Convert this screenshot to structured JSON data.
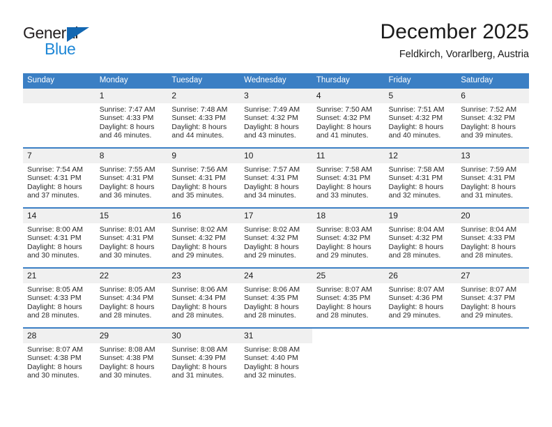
{
  "logo": {
    "word1": "General",
    "word2": "Blue",
    "triangle_color": "#1267b2",
    "word2_color": "#1e87d6"
  },
  "header": {
    "title": "December 2025",
    "subtitle": "Feldkirch, Vorarlberg, Austria"
  },
  "theme": {
    "header_bg": "#3b7fc4",
    "daynum_bg": "#f0f0f0",
    "text": "#1a1a1a"
  },
  "calendar": {
    "weekday_headers": [
      "Sunday",
      "Monday",
      "Tuesday",
      "Wednesday",
      "Thursday",
      "Friday",
      "Saturday"
    ],
    "weeks": [
      [
        {
          "day": "",
          "blank": true,
          "sunrise": "",
          "sunset": "",
          "daylight1": "",
          "daylight2": ""
        },
        {
          "day": "1",
          "sunrise": "Sunrise: 7:47 AM",
          "sunset": "Sunset: 4:33 PM",
          "daylight1": "Daylight: 8 hours",
          "daylight2": "and 46 minutes."
        },
        {
          "day": "2",
          "sunrise": "Sunrise: 7:48 AM",
          "sunset": "Sunset: 4:33 PM",
          "daylight1": "Daylight: 8 hours",
          "daylight2": "and 44 minutes."
        },
        {
          "day": "3",
          "sunrise": "Sunrise: 7:49 AM",
          "sunset": "Sunset: 4:32 PM",
          "daylight1": "Daylight: 8 hours",
          "daylight2": "and 43 minutes."
        },
        {
          "day": "4",
          "sunrise": "Sunrise: 7:50 AM",
          "sunset": "Sunset: 4:32 PM",
          "daylight1": "Daylight: 8 hours",
          "daylight2": "and 41 minutes."
        },
        {
          "day": "5",
          "sunrise": "Sunrise: 7:51 AM",
          "sunset": "Sunset: 4:32 PM",
          "daylight1": "Daylight: 8 hours",
          "daylight2": "and 40 minutes."
        },
        {
          "day": "6",
          "sunrise": "Sunrise: 7:52 AM",
          "sunset": "Sunset: 4:32 PM",
          "daylight1": "Daylight: 8 hours",
          "daylight2": "and 39 minutes."
        }
      ],
      [
        {
          "day": "7",
          "sunrise": "Sunrise: 7:54 AM",
          "sunset": "Sunset: 4:31 PM",
          "daylight1": "Daylight: 8 hours",
          "daylight2": "and 37 minutes."
        },
        {
          "day": "8",
          "sunrise": "Sunrise: 7:55 AM",
          "sunset": "Sunset: 4:31 PM",
          "daylight1": "Daylight: 8 hours",
          "daylight2": "and 36 minutes."
        },
        {
          "day": "9",
          "sunrise": "Sunrise: 7:56 AM",
          "sunset": "Sunset: 4:31 PM",
          "daylight1": "Daylight: 8 hours",
          "daylight2": "and 35 minutes."
        },
        {
          "day": "10",
          "sunrise": "Sunrise: 7:57 AM",
          "sunset": "Sunset: 4:31 PM",
          "daylight1": "Daylight: 8 hours",
          "daylight2": "and 34 minutes."
        },
        {
          "day": "11",
          "sunrise": "Sunrise: 7:58 AM",
          "sunset": "Sunset: 4:31 PM",
          "daylight1": "Daylight: 8 hours",
          "daylight2": "and 33 minutes."
        },
        {
          "day": "12",
          "sunrise": "Sunrise: 7:58 AM",
          "sunset": "Sunset: 4:31 PM",
          "daylight1": "Daylight: 8 hours",
          "daylight2": "and 32 minutes."
        },
        {
          "day": "13",
          "sunrise": "Sunrise: 7:59 AM",
          "sunset": "Sunset: 4:31 PM",
          "daylight1": "Daylight: 8 hours",
          "daylight2": "and 31 minutes."
        }
      ],
      [
        {
          "day": "14",
          "sunrise": "Sunrise: 8:00 AM",
          "sunset": "Sunset: 4:31 PM",
          "daylight1": "Daylight: 8 hours",
          "daylight2": "and 30 minutes."
        },
        {
          "day": "15",
          "sunrise": "Sunrise: 8:01 AM",
          "sunset": "Sunset: 4:31 PM",
          "daylight1": "Daylight: 8 hours",
          "daylight2": "and 30 minutes."
        },
        {
          "day": "16",
          "sunrise": "Sunrise: 8:02 AM",
          "sunset": "Sunset: 4:32 PM",
          "daylight1": "Daylight: 8 hours",
          "daylight2": "and 29 minutes."
        },
        {
          "day": "17",
          "sunrise": "Sunrise: 8:02 AM",
          "sunset": "Sunset: 4:32 PM",
          "daylight1": "Daylight: 8 hours",
          "daylight2": "and 29 minutes."
        },
        {
          "day": "18",
          "sunrise": "Sunrise: 8:03 AM",
          "sunset": "Sunset: 4:32 PM",
          "daylight1": "Daylight: 8 hours",
          "daylight2": "and 29 minutes."
        },
        {
          "day": "19",
          "sunrise": "Sunrise: 8:04 AM",
          "sunset": "Sunset: 4:32 PM",
          "daylight1": "Daylight: 8 hours",
          "daylight2": "and 28 minutes."
        },
        {
          "day": "20",
          "sunrise": "Sunrise: 8:04 AM",
          "sunset": "Sunset: 4:33 PM",
          "daylight1": "Daylight: 8 hours",
          "daylight2": "and 28 minutes."
        }
      ],
      [
        {
          "day": "21",
          "sunrise": "Sunrise: 8:05 AM",
          "sunset": "Sunset: 4:33 PM",
          "daylight1": "Daylight: 8 hours",
          "daylight2": "and 28 minutes."
        },
        {
          "day": "22",
          "sunrise": "Sunrise: 8:05 AM",
          "sunset": "Sunset: 4:34 PM",
          "daylight1": "Daylight: 8 hours",
          "daylight2": "and 28 minutes."
        },
        {
          "day": "23",
          "sunrise": "Sunrise: 8:06 AM",
          "sunset": "Sunset: 4:34 PM",
          "daylight1": "Daylight: 8 hours",
          "daylight2": "and 28 minutes."
        },
        {
          "day": "24",
          "sunrise": "Sunrise: 8:06 AM",
          "sunset": "Sunset: 4:35 PM",
          "daylight1": "Daylight: 8 hours",
          "daylight2": "and 28 minutes."
        },
        {
          "day": "25",
          "sunrise": "Sunrise: 8:07 AM",
          "sunset": "Sunset: 4:35 PM",
          "daylight1": "Daylight: 8 hours",
          "daylight2": "and 28 minutes."
        },
        {
          "day": "26",
          "sunrise": "Sunrise: 8:07 AM",
          "sunset": "Sunset: 4:36 PM",
          "daylight1": "Daylight: 8 hours",
          "daylight2": "and 29 minutes."
        },
        {
          "day": "27",
          "sunrise": "Sunrise: 8:07 AM",
          "sunset": "Sunset: 4:37 PM",
          "daylight1": "Daylight: 8 hours",
          "daylight2": "and 29 minutes."
        }
      ],
      [
        {
          "day": "28",
          "sunrise": "Sunrise: 8:07 AM",
          "sunset": "Sunset: 4:38 PM",
          "daylight1": "Daylight: 8 hours",
          "daylight2": "and 30 minutes."
        },
        {
          "day": "29",
          "sunrise": "Sunrise: 8:08 AM",
          "sunset": "Sunset: 4:38 PM",
          "daylight1": "Daylight: 8 hours",
          "daylight2": "and 30 minutes."
        },
        {
          "day": "30",
          "sunrise": "Sunrise: 8:08 AM",
          "sunset": "Sunset: 4:39 PM",
          "daylight1": "Daylight: 8 hours",
          "daylight2": "and 31 minutes."
        },
        {
          "day": "31",
          "sunrise": "Sunrise: 8:08 AM",
          "sunset": "Sunset: 4:40 PM",
          "daylight1": "Daylight: 8 hours",
          "daylight2": "and 32 minutes."
        },
        {
          "day": "",
          "empty": true,
          "sunrise": "",
          "sunset": "",
          "daylight1": "",
          "daylight2": ""
        },
        {
          "day": "",
          "empty": true,
          "sunrise": "",
          "sunset": "",
          "daylight1": "",
          "daylight2": ""
        },
        {
          "day": "",
          "empty": true,
          "sunrise": "",
          "sunset": "",
          "daylight1": "",
          "daylight2": ""
        }
      ]
    ]
  }
}
